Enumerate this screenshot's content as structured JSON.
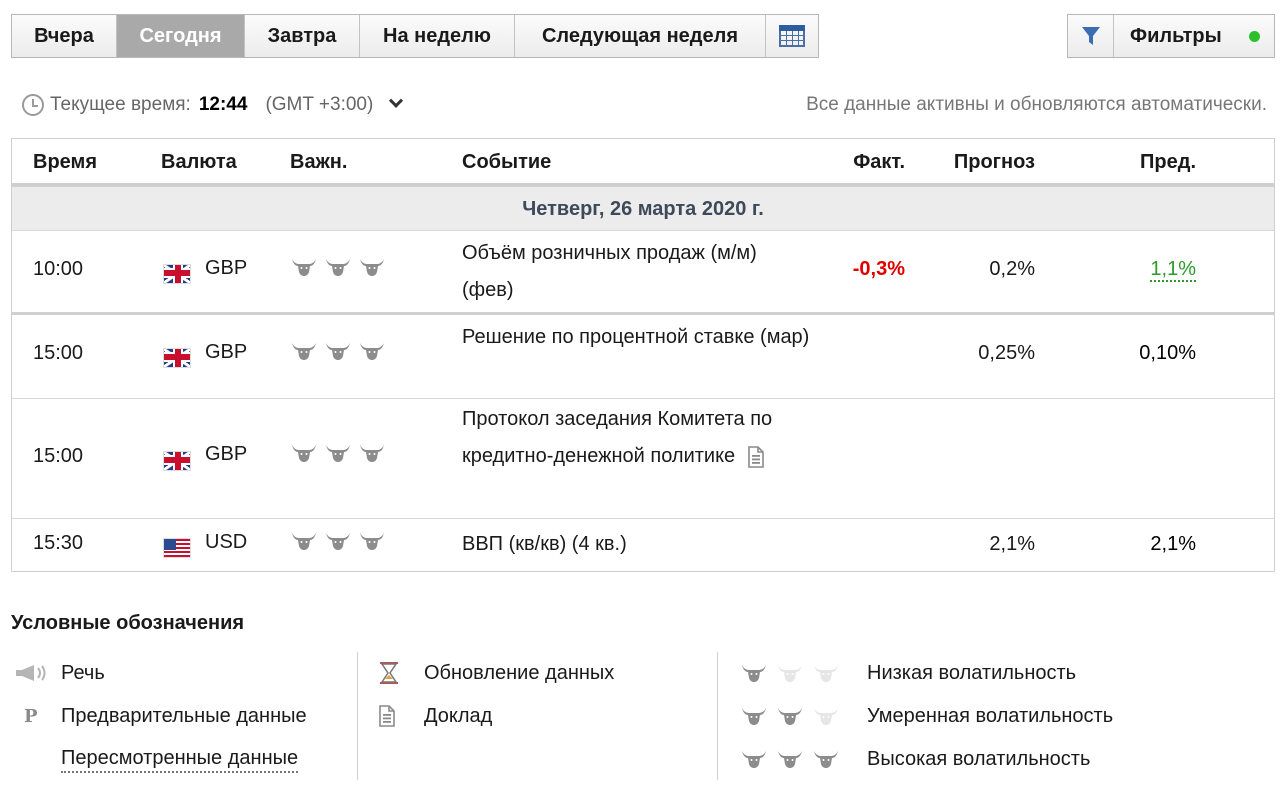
{
  "tabs": [
    {
      "label": "Вчера",
      "active": false
    },
    {
      "label": "Сегодня",
      "active": true
    },
    {
      "label": "Завтра",
      "active": false
    },
    {
      "label": "На неделю",
      "active": false
    },
    {
      "label": "Следующая неделя",
      "active": false
    }
  ],
  "filters": {
    "label": "Фильтры"
  },
  "time": {
    "label": "Текущее время:",
    "value": "12:44",
    "timezone": "(GMT +3:00)"
  },
  "auto_note": "Все данные активны и обновляются автоматически.",
  "columns": {
    "time": "Время",
    "currency": "Валюта",
    "importance": "Важн.",
    "event": "Событие",
    "actual": "Факт.",
    "forecast": "Прогноз",
    "previous": "Пред."
  },
  "day": "Четверг, 26 марта 2020 г.",
  "events": [
    {
      "time": "10:00",
      "flag": "gb",
      "currency": "GBP",
      "importance": 3,
      "event": "Объём розничных продаж (м/м) (фев)",
      "actual": "-0,3%",
      "forecast": "0,2%",
      "previous": "1,1%",
      "previous_color": "green",
      "has_doc": false
    },
    {
      "time": "15:00",
      "flag": "gb",
      "currency": "GBP",
      "importance": 3,
      "event": "Решение по процентной ставке (мар)",
      "actual": "",
      "forecast": "0,25%",
      "previous": "0,10%",
      "previous_color": "",
      "has_doc": false
    },
    {
      "time": "15:00",
      "flag": "gb",
      "currency": "GBP",
      "importance": 3,
      "event": "Протокол заседания Комитета по кредитно-денежной политике",
      "actual": "",
      "forecast": "",
      "previous": "",
      "previous_color": "",
      "has_doc": true
    },
    {
      "time": "15:30",
      "flag": "us",
      "currency": "USD",
      "importance": 3,
      "event": "ВВП (кв/кв) (4 кв.)",
      "actual": "",
      "forecast": "2,1%",
      "previous": "2,1%",
      "previous_color": "",
      "has_doc": false
    }
  ],
  "legend": {
    "title": "Условные обозначения",
    "speech": "Речь",
    "preliminary": "Предварительные данные",
    "revised": "Пересмотренные данные",
    "data_update": "Обновление данных",
    "report": "Доклад",
    "low_vol": "Низкая волатильность",
    "mid_vol": "Умеренная волатильность",
    "high_vol": "Высокая волатильность"
  },
  "colors": {
    "actual_negative": "#e00000",
    "previous_positive": "#2b9a2b",
    "active_tab": "#a9a9a9",
    "live_dot": "#2dc02d"
  },
  "icons": {
    "calendar": "calendar-icon",
    "filter": "filter-funnel-icon",
    "clock": "clock-icon",
    "bull": "bull-head-icon",
    "document": "document-icon",
    "megaphone": "megaphone-icon",
    "hourglass": "hourglass-icon"
  }
}
